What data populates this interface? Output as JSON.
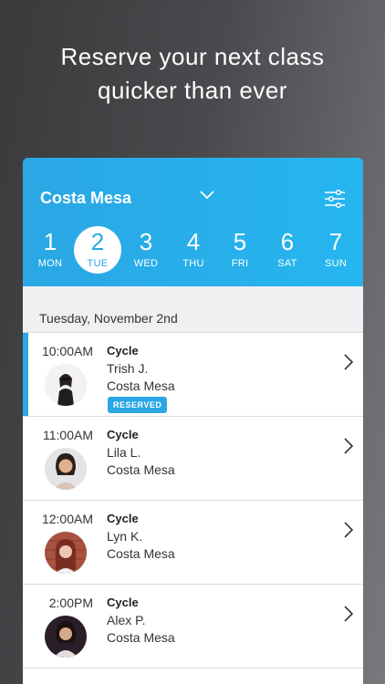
{
  "tagline": {
    "line1": "Reserve your next class",
    "line2": "quicker than ever"
  },
  "header": {
    "location": "Costa Mesa",
    "days": [
      {
        "num": "1",
        "dow": "MON"
      },
      {
        "num": "2",
        "dow": "TUE",
        "selected": true
      },
      {
        "num": "3",
        "dow": "WED"
      },
      {
        "num": "4",
        "dow": "THU"
      },
      {
        "num": "5",
        "dow": "FRI"
      },
      {
        "num": "6",
        "dow": "SAT"
      },
      {
        "num": "7",
        "dow": "SUN"
      }
    ]
  },
  "date_heading": "Tuesday, November 2nd",
  "classes": [
    {
      "time": "10:00AM",
      "name": "Cycle",
      "instructor": "Trish J.",
      "studio": "Costa Mesa",
      "badge": "RESERVED"
    },
    {
      "time": "11:00AM",
      "name": "Cycle",
      "instructor": "Lila L.",
      "studio": "Costa Mesa"
    },
    {
      "time": "12:00AM",
      "name": "Cycle",
      "instructor": "Lyn K.",
      "studio": "Costa Mesa"
    },
    {
      "time": "2:00PM",
      "name": "Cycle",
      "instructor": "Alex P.",
      "studio": "Costa Mesa"
    }
  ],
  "colors": {
    "accent": "#2aa7e4",
    "background_dark": "#3a3a3c"
  }
}
